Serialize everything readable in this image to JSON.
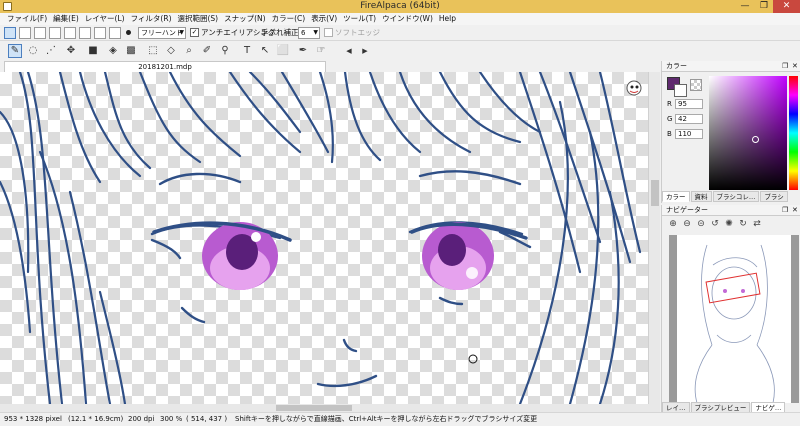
{
  "window": {
    "title": "FireAlpaca (64bit)",
    "min": "—",
    "max": "❐",
    "close": "✕"
  },
  "menu": [
    "ファイル(F)",
    "編集(E)",
    "レイヤー(L)",
    "フィルタ(R)",
    "選択範囲(S)",
    "スナップ(N)",
    "カラー(C)",
    "表示(V)",
    "ツール(T)",
    "ウインドウ(W)",
    "Help"
  ],
  "toolbar1": {
    "brush_mode": "フリーハンド",
    "antialias_label": "アンチエイリアシング",
    "antialias_checked": "✓",
    "stabilizer_label": "手ぶれ補正",
    "stabilizer_value": "6",
    "soft_edge_label": "ソフトエッジ"
  },
  "toolbar2": {
    "tools": [
      "✎",
      "◌",
      "⋰",
      "✥",
      "■",
      "◈",
      "▩",
      "⬚",
      "◇",
      "⌕",
      "✐",
      "⚲",
      "T",
      "↖",
      "⬜",
      "✒",
      "☞"
    ],
    "nav_prev": "◀",
    "nav_next": "▶"
  },
  "document": {
    "tab_name": "20181201.mdp"
  },
  "status": {
    "size": "953 * 1328 pixel",
    "physical": "(12.1 * 16.9cm)",
    "dpi": "200 dpi",
    "zoom": "300 %",
    "coords": "( 514, 437 )",
    "hint": "Shiftキーを押しながらで直線描画、Ctrl+Altキーを押しながら左右ドラッグでブラシサイズ変更"
  },
  "color_panel": {
    "title": "カラー",
    "r_label": "R",
    "r": "95",
    "g_label": "G",
    "g": "42",
    "b_label": "B",
    "b": "110",
    "fg_color": "#5f2a6e",
    "tabs": [
      "カラー",
      "資料",
      "ブラシコレ…",
      "ブラシ"
    ]
  },
  "navigator_panel": {
    "title": "ナビゲーター",
    "tools": [
      "⊕",
      "⊖",
      "⊝",
      "↺",
      "✺",
      "↻",
      "⇄"
    ],
    "tabs": [
      "レイ…",
      "ブラシプレビュー",
      "ナビゲ…"
    ]
  },
  "panel_btn": {
    "restore": "❐",
    "close": "✕"
  },
  "theme": {
    "titlebar": "#e9c25a",
    "line_art": "#2f4f86",
    "eye_color": "#c26ad6"
  }
}
